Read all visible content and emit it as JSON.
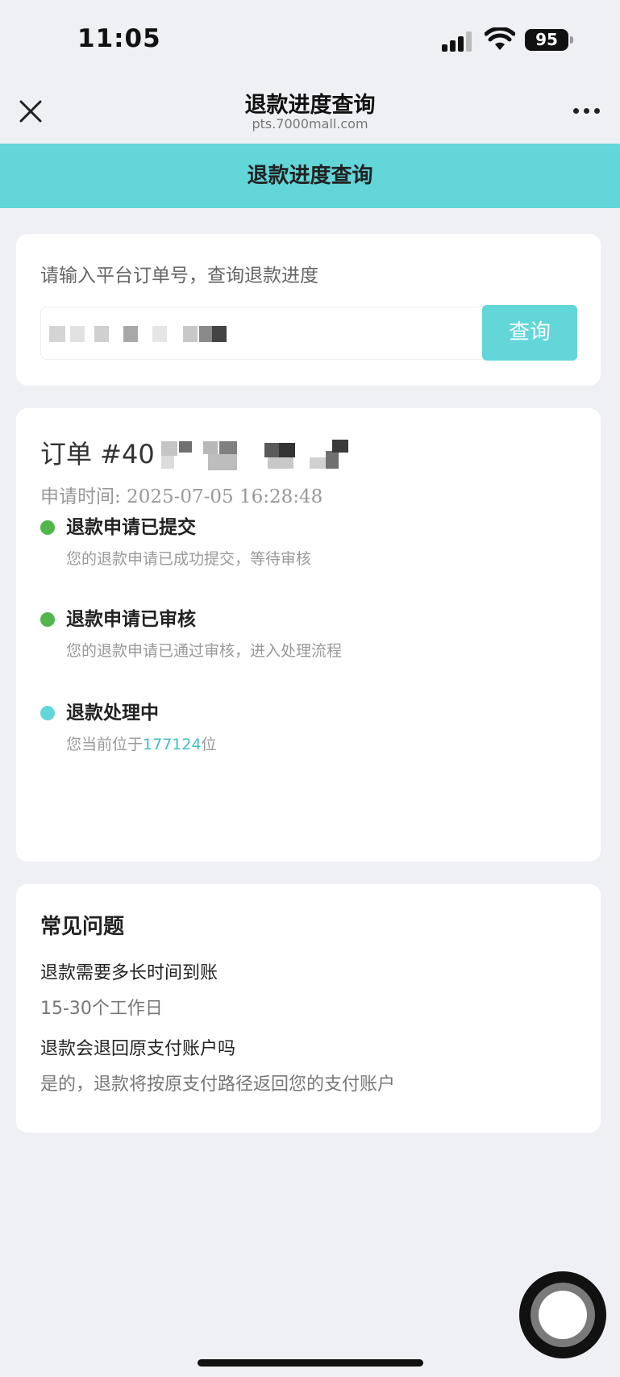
{
  "status_bar": {
    "time": "11:05",
    "battery": "95"
  },
  "nav": {
    "title": "退款进度查询",
    "url": "pts.7000mall.com",
    "close_icon": "close-icon",
    "more_icon": "more-icon"
  },
  "page_header": {
    "title": "退款进度查询"
  },
  "search": {
    "hint": "请输入平台订单号，查询退款进度",
    "button_label": "查询"
  },
  "order": {
    "title_prefix": "订单 #40",
    "apply_time": "申请时间: 2025-07-05 16:28:48",
    "steps": [
      {
        "title": "退款申请已提交",
        "desc": "您的退款申请已成功提交，等待审核",
        "color": "#52b64a"
      },
      {
        "title": "退款申请已审核",
        "desc": "您的退款申请已通过审核，进入处理流程",
        "color": "#52b64a"
      },
      {
        "title": "退款处理中",
        "desc_prefix": "您当前位于",
        "desc_number": "177124",
        "desc_suffix": "位",
        "color": "#62d6d9"
      }
    ]
  },
  "faq": {
    "title": "常见问题",
    "items": [
      {
        "question": "退款需要多长时间到账",
        "answer": "15-30个工作日"
      },
      {
        "question": "退款会退回原支付账户吗",
        "answer": "是的，退款将按原支付路径返回您的支付账户"
      }
    ]
  },
  "colors": {
    "accent": "#62d6d9",
    "success": "#52b64a",
    "background": "#eff0f3"
  }
}
